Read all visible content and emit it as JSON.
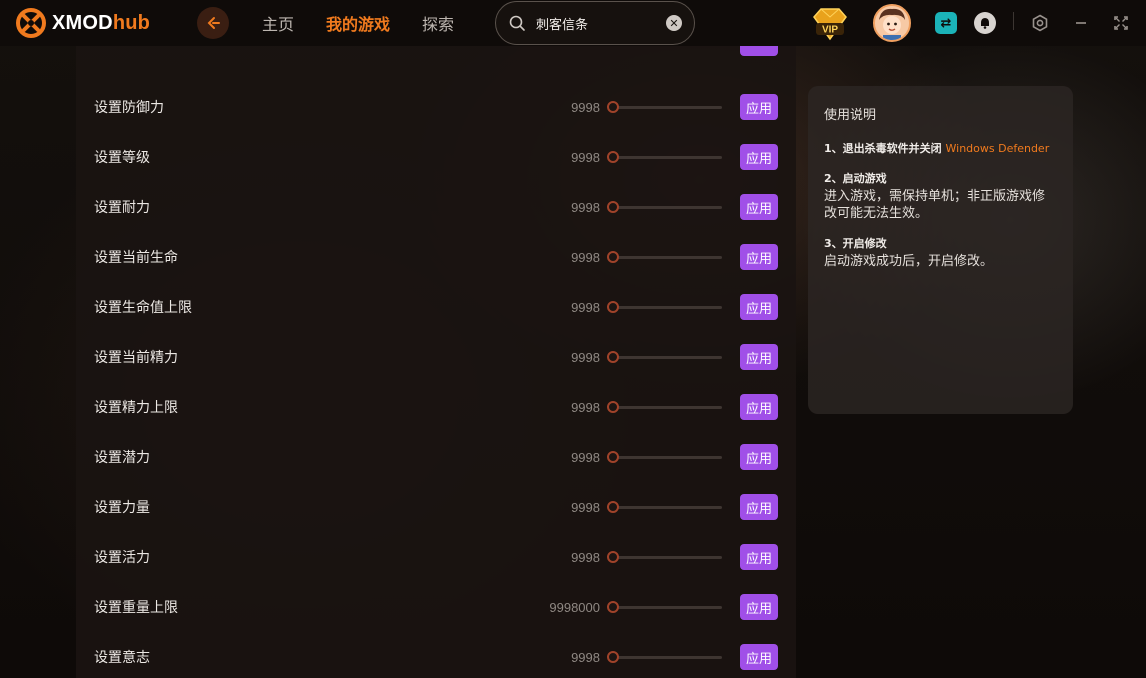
{
  "app": {
    "logo_main": "XMOD",
    "logo_accent": "hub",
    "accent_color": "#f07a1e",
    "apply_color": "#a04fe8"
  },
  "nav": {
    "items": [
      {
        "label": "主页",
        "active": false
      },
      {
        "label": "我的游戏",
        "active": true
      },
      {
        "label": "探索",
        "active": false
      }
    ]
  },
  "search": {
    "value": "刺客信条",
    "icon": "search-icon"
  },
  "topbar_icons": [
    "back-arrow-icon",
    "vip-badge-icon",
    "avatar",
    "swap-icon",
    "bell-icon",
    "gear-icon",
    "minimize-icon",
    "fullscreen-icon"
  ],
  "vip_label": "VIP",
  "cheats": [
    {
      "label": "设置防御力",
      "value": "9998",
      "button": "应用"
    },
    {
      "label": "设置等级",
      "value": "9998",
      "button": "应用"
    },
    {
      "label": "设置耐力",
      "value": "9998",
      "button": "应用"
    },
    {
      "label": "设置当前生命",
      "value": "9998",
      "button": "应用"
    },
    {
      "label": "设置生命值上限",
      "value": "9998",
      "button": "应用"
    },
    {
      "label": "设置当前精力",
      "value": "9998",
      "button": "应用"
    },
    {
      "label": "设置精力上限",
      "value": "9998",
      "button": "应用"
    },
    {
      "label": "设置潜力",
      "value": "9998",
      "button": "应用"
    },
    {
      "label": "设置力量",
      "value": "9998",
      "button": "应用"
    },
    {
      "label": "设置活力",
      "value": "9998",
      "button": "应用"
    },
    {
      "label": "设置重量上限",
      "value": "9998000",
      "button": "应用"
    },
    {
      "label": "设置意志",
      "value": "9998",
      "button": "应用"
    }
  ],
  "instructions": {
    "title": "使用说明",
    "step1_head": "1、退出杀毒软件并关闭",
    "step1_highlight": "Windows Defender",
    "step2_head": "2、启动游戏",
    "step2_body": "进入游戏，需保持单机；非正版游戏修改可能无法生效。",
    "step3_head": "3、开启修改",
    "step3_body": "启动游戏成功后，开启修改。"
  }
}
